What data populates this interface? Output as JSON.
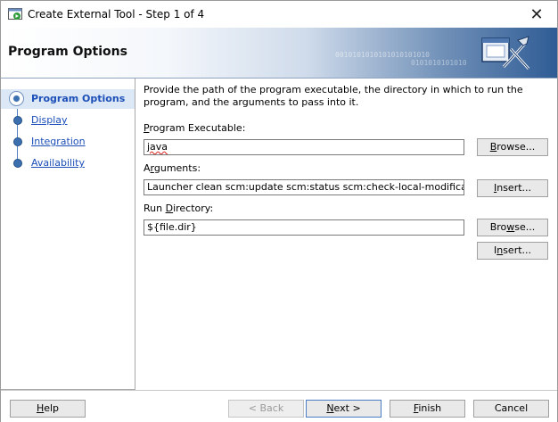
{
  "window": {
    "title": "Create External Tool - Step 1 of 4",
    "close_glyph": "✕"
  },
  "banner": {
    "title": "Program Options",
    "decor_binary_1": "0010101010101010101010",
    "decor_binary_2": "0101010101010"
  },
  "nav": {
    "items": [
      {
        "label": "Program Options",
        "active": true
      },
      {
        "label": "Display",
        "active": false
      },
      {
        "label": "Integration",
        "active": false
      },
      {
        "label": "Availability",
        "active": false
      }
    ]
  },
  "main": {
    "description": "Provide the path of the program executable, the directory in which to run the program, and the arguments to pass into it.",
    "program_executable": {
      "label_u": "P",
      "label_rest": "rogram Executable:",
      "value": "java",
      "browse_u": "B",
      "browse_rest": "rowse..."
    },
    "arguments": {
      "label_pre": "A",
      "label_u": "r",
      "label_rest": "guments:",
      "value": "Launcher clean scm:update scm:status scm:check-local-modification install",
      "insert_u": "I",
      "insert_rest": "nsert..."
    },
    "run_directory": {
      "label_pre": "Run ",
      "label_u": "D",
      "label_rest": "irectory:",
      "value": "${file.dir}",
      "browse_pre": "Bro",
      "browse_u": "w",
      "browse_rest": "se...",
      "insert_pre": "I",
      "insert_u": "n",
      "insert_rest": "sert..."
    }
  },
  "footer": {
    "help_u": "H",
    "help_rest": "elp",
    "back_label": "< Back",
    "next_u": "N",
    "next_rest": "ext >",
    "finish_u": "F",
    "finish_rest": "inish",
    "cancel_label": "Cancel"
  },
  "colors": {
    "link": "#1c4fb8",
    "nav_active_bg": "#dce8f6",
    "banner_dark": "#2f5c95"
  }
}
